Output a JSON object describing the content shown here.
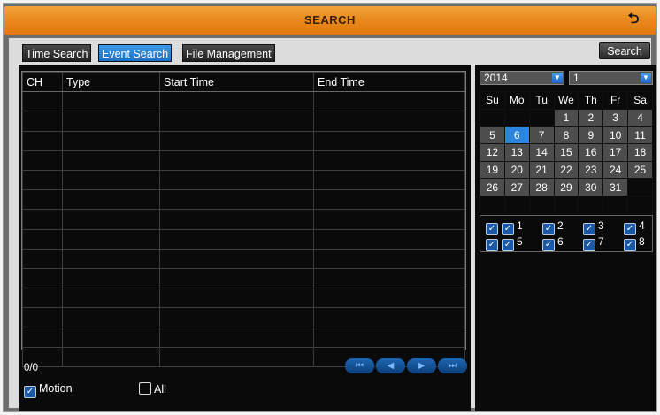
{
  "title": "SEARCH",
  "icons": {
    "back": "return-arrow-icon"
  },
  "tabs": [
    {
      "label": "Time Search",
      "active": false
    },
    {
      "label": "Event Search",
      "active": true
    },
    {
      "label": "File Management",
      "active": false
    }
  ],
  "search_button": "Search",
  "table": {
    "columns": [
      "CH",
      "Type",
      "Start Time",
      "End Time"
    ],
    "rows_visible": 14
  },
  "pager": {
    "count": "0/0"
  },
  "filters": {
    "motion": {
      "label": "Motion",
      "checked": true
    },
    "all": {
      "label": "All",
      "checked": false
    }
  },
  "calendar": {
    "year": "2014",
    "month": "1",
    "weekdays": [
      "Su",
      "Mo",
      "Tu",
      "We",
      "Th",
      "Fr",
      "Sa"
    ],
    "selected_day": "6",
    "weeks": [
      [
        "",
        "",
        "",
        "1",
        "2",
        "3",
        "4"
      ],
      [
        "5",
        "6",
        "7",
        "8",
        "9",
        "10",
        "11"
      ],
      [
        "12",
        "13",
        "14",
        "15",
        "16",
        "17",
        "18"
      ],
      [
        "19",
        "20",
        "21",
        "22",
        "23",
        "24",
        "25"
      ],
      [
        "26",
        "27",
        "28",
        "29",
        "30",
        "31",
        ""
      ],
      [
        "",
        "",
        "",
        "",
        "",
        "",
        ""
      ]
    ]
  },
  "channels": {
    "all_checked": true,
    "items": [
      "1",
      "2",
      "3",
      "4",
      "5",
      "6",
      "7",
      "8"
    ]
  },
  "colors": {
    "accent": "#e8871a",
    "selected": "#2b85e0"
  }
}
